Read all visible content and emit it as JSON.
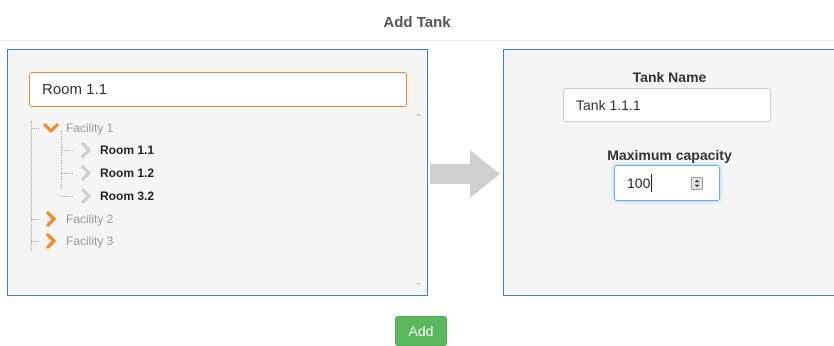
{
  "page": {
    "title": "Add Tank"
  },
  "search": {
    "value": "Room 1.1"
  },
  "tree": {
    "facilities": [
      {
        "label": "Facility 1",
        "expanded": true,
        "rooms": [
          "Room 1.1",
          "Room 1.2",
          "Room 3.2"
        ]
      },
      {
        "label": "Facility 2",
        "expanded": false
      },
      {
        "label": "Facility 3",
        "expanded": false
      }
    ]
  },
  "form": {
    "tank_name_label": "Tank Name",
    "tank_name_value": "Tank 1.1.1",
    "capacity_label": "Maximum capacity",
    "capacity_value": "100"
  },
  "actions": {
    "add_label": "Add"
  },
  "colors": {
    "accent_orange": "#f08a24",
    "panel_border": "#3d7fc6",
    "add_green": "#5cb85c",
    "arrow_gray": "#cfcfcf"
  }
}
